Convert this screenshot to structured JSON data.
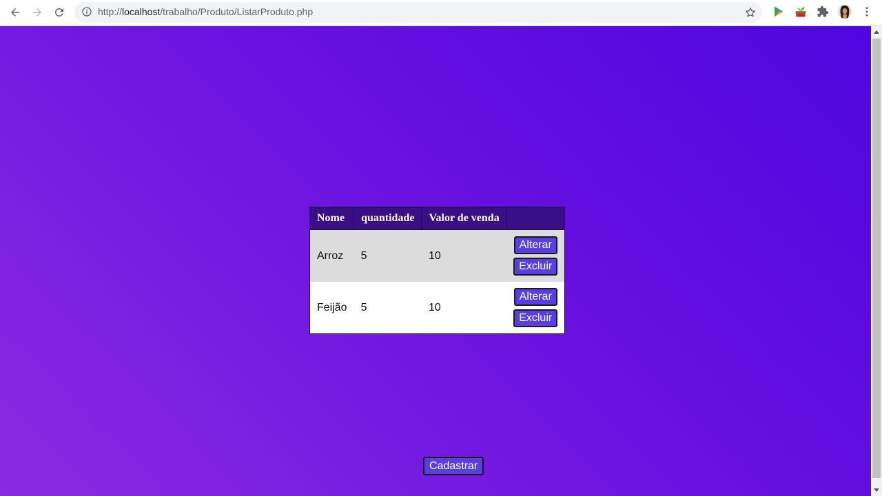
{
  "browser": {
    "url_prefix": "http://",
    "url_host": "localhost",
    "url_path": "/trabalho/Produto/ListarProduto.php"
  },
  "table": {
    "headers": [
      "Nome",
      "quantidade",
      "Valor de venda",
      ""
    ],
    "rows": [
      {
        "nome": "Arroz",
        "quantidade": "5",
        "valor": "10",
        "alterar": "Alterar",
        "excluir": "Excluir"
      },
      {
        "nome": "Feijão",
        "quantidade": "5",
        "valor": "10",
        "alterar": "Alterar",
        "excluir": "Excluir"
      }
    ]
  },
  "actions": {
    "cadastrar_label": "Cadastrar"
  },
  "colors": {
    "header_bg": "#3a0f86",
    "button_bg": "#5a3fe0",
    "gradient_start": "#4f06e0",
    "gradient_end": "#8a2be2"
  }
}
